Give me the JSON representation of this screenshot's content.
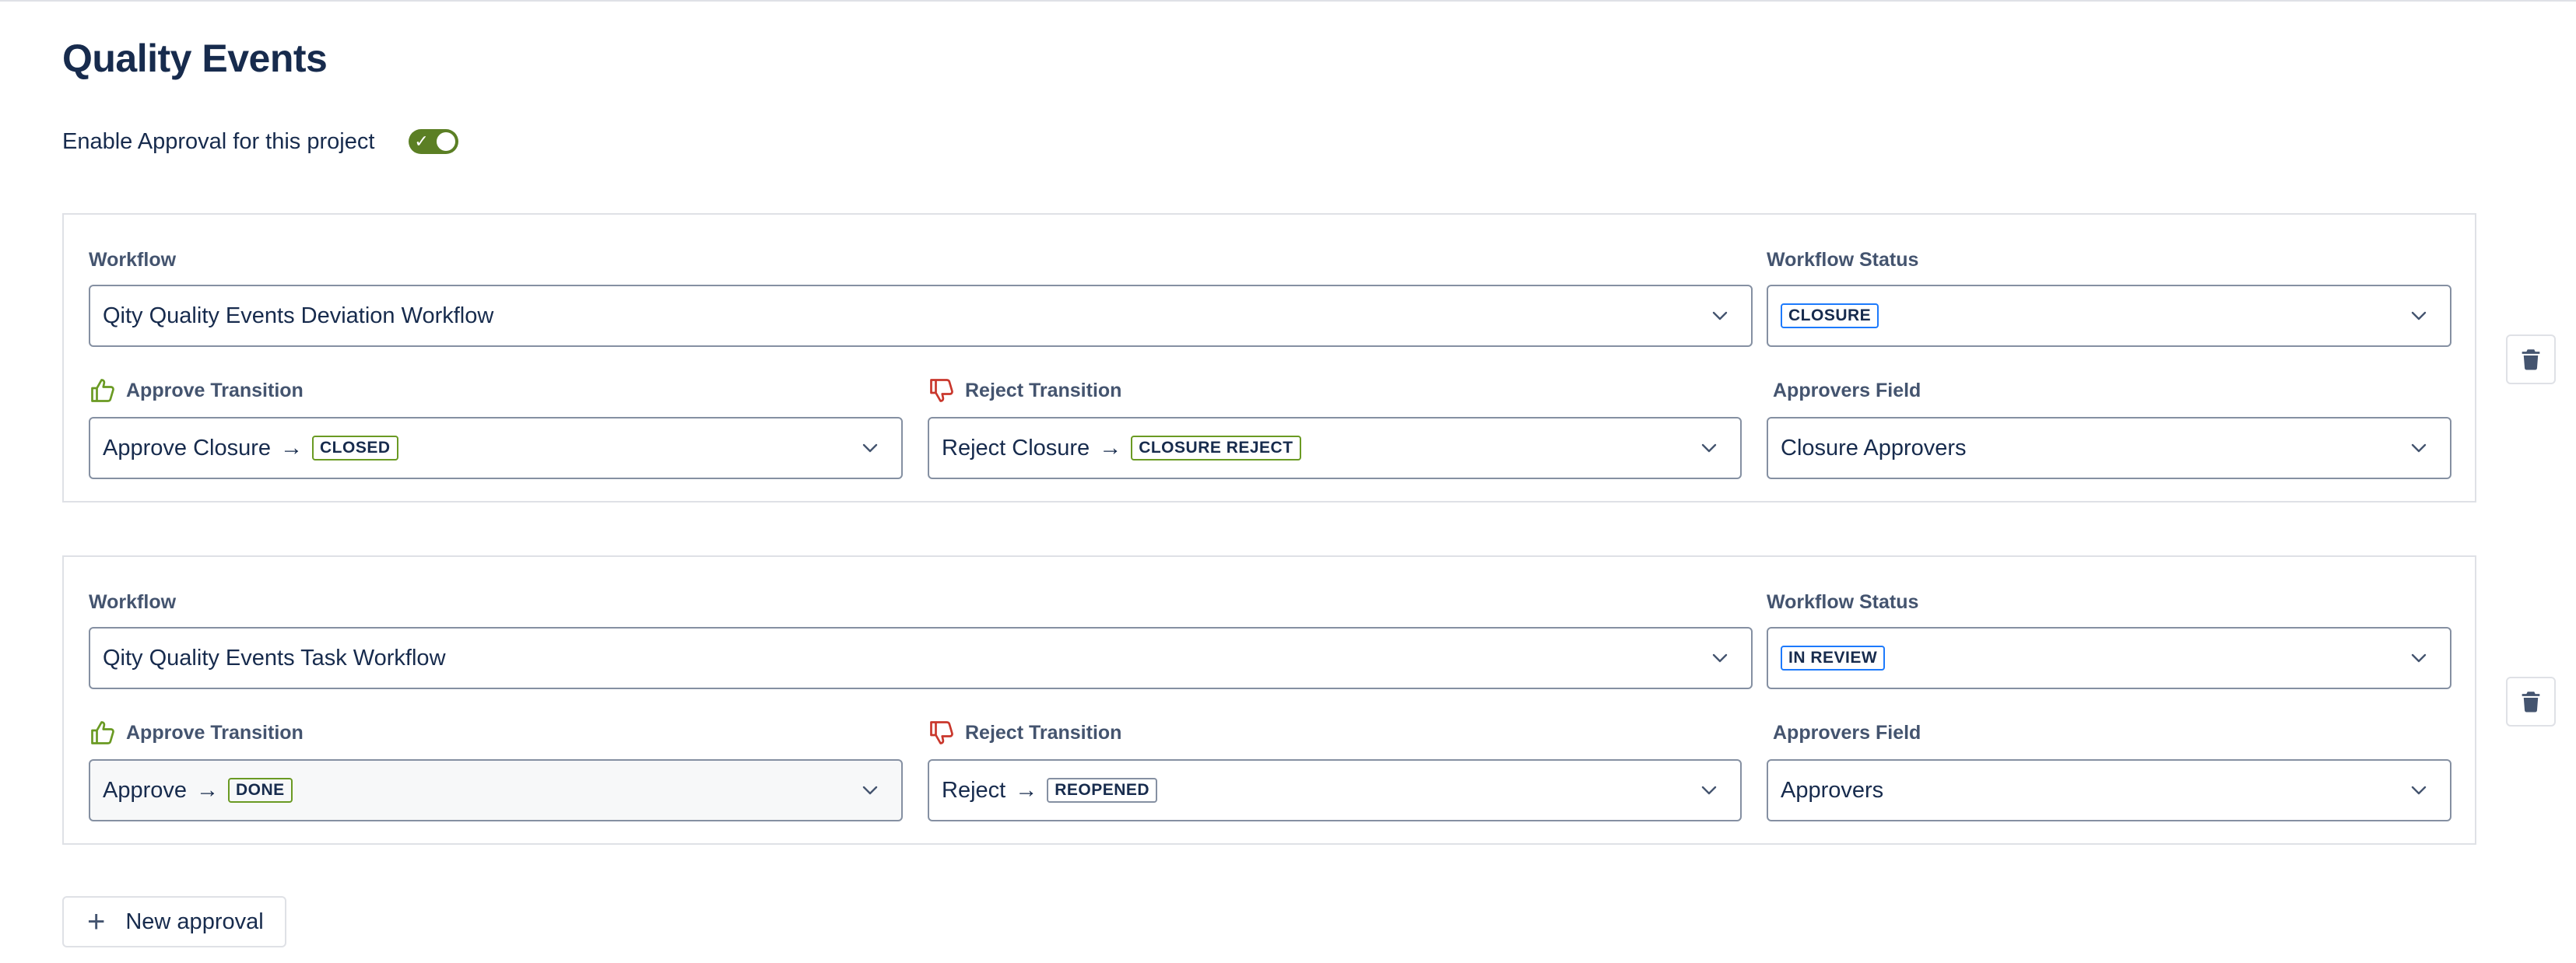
{
  "page": {
    "title": "Quality Events",
    "enable_label": "Enable Approval for this project",
    "enable_on": true
  },
  "colors": {
    "accent_green": "#5b7f24",
    "approve_icon": "#6a9a23",
    "reject_icon": "#c9372c",
    "lozenge_blue": "#1d7afc"
  },
  "labels": {
    "workflow": "Workflow",
    "workflow_status": "Workflow Status",
    "approve_transition": "Approve Transition",
    "reject_transition": "Reject Transition",
    "approvers_field": "Approvers Field"
  },
  "approvals": [
    {
      "workflow": "Qity Quality Events Deviation Workflow",
      "status": "CLOSURE",
      "approve_name": "Approve Closure",
      "approve_target": "CLOSED",
      "reject_name": "Reject Closure",
      "reject_target": "CLOSURE REJECT",
      "approvers_field": "Closure Approvers"
    },
    {
      "workflow": "Qity Quality Events Task Workflow",
      "status": "IN REVIEW",
      "approve_name": "Approve",
      "approve_target": "DONE",
      "reject_name": "Reject",
      "reject_target": "REOPENED",
      "approvers_field": "Approvers"
    }
  ],
  "actions": {
    "new_approval_label": "New approval"
  },
  "icons": {
    "approve": "thumbs-up-icon",
    "reject": "thumbs-down-icon",
    "dropdown": "chevron-down-icon",
    "delete": "trash-icon",
    "add": "plus-icon",
    "toggle_on": "check-icon"
  }
}
